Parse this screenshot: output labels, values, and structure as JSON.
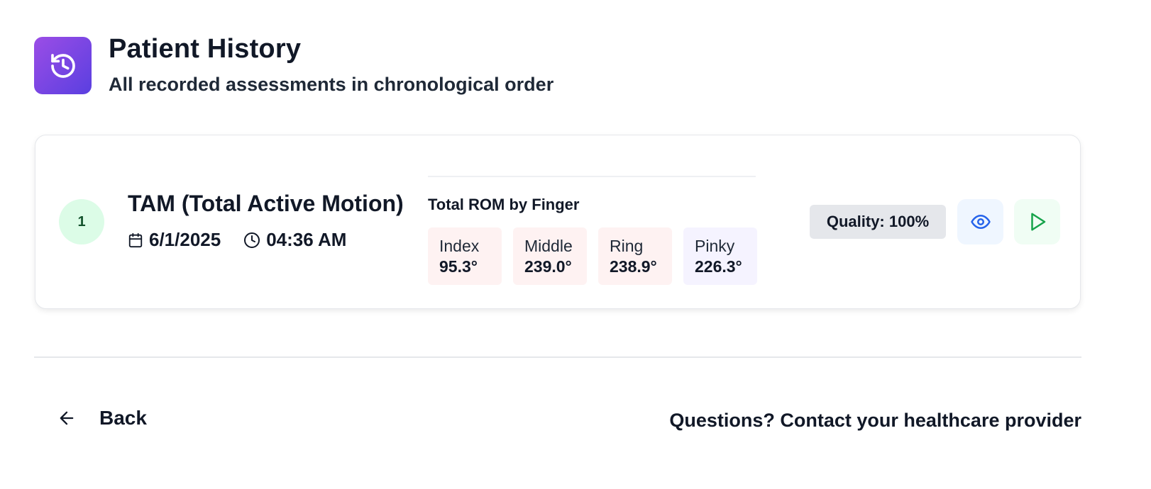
{
  "header": {
    "title": "Patient History",
    "subtitle": "All recorded assessments in chronological order",
    "icon": "history-icon"
  },
  "assessments": [
    {
      "index": "1",
      "title": "TAM (Total Active Motion)",
      "date": "6/1/2025",
      "time": "04:36 AM",
      "rom_title": "Total ROM by Finger",
      "fingers": [
        {
          "label": "Index",
          "value": "95.3°",
          "color": "#fef2f2"
        },
        {
          "label": "Middle",
          "value": "239.0°",
          "color": "#fef2f2"
        },
        {
          "label": "Ring",
          "value": "238.9°",
          "color": "#fef2f2"
        },
        {
          "label": "Pinky",
          "value": "226.3°",
          "color": "#f5f3ff"
        }
      ],
      "quality": "Quality: 100%",
      "actions": {
        "view_icon": "eye-icon",
        "play_icon": "play-icon"
      }
    }
  ],
  "footer": {
    "back_label": "Back",
    "contact_text": "Questions? Contact your healthcare provider"
  },
  "colors": {
    "accent_gradient_start": "#9b4de6",
    "accent_gradient_end": "#5a3fe0",
    "view_icon": "#2563eb",
    "play_icon": "#16a34a"
  }
}
